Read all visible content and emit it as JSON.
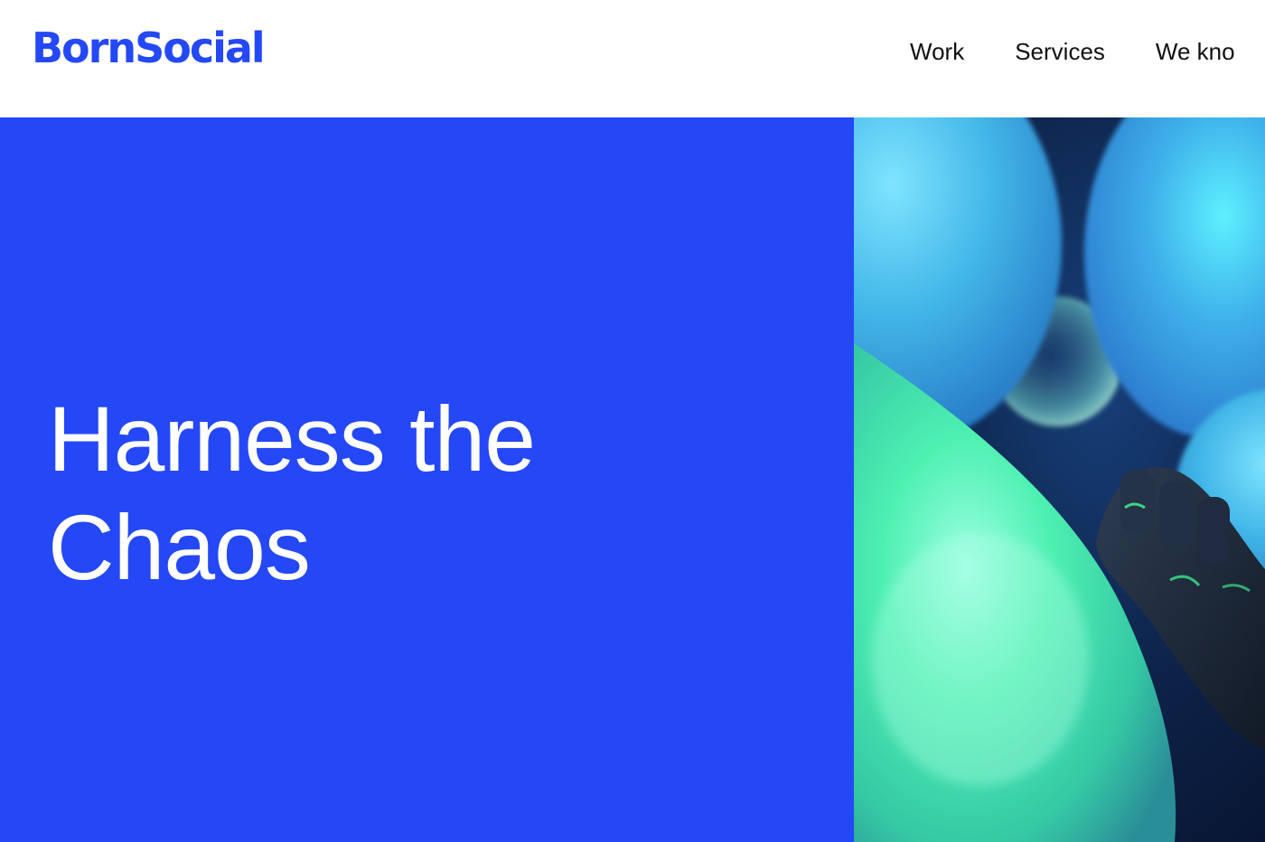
{
  "brand": {
    "name": "BornSocial",
    "color": "#2448f6"
  },
  "nav": {
    "items": [
      {
        "label": "Work"
      },
      {
        "label": "Services"
      },
      {
        "label": "We kno"
      }
    ]
  },
  "hero": {
    "background": "#2448f6",
    "title_line_1": "Harness the",
    "title_line_2": "Chaos",
    "image": {
      "description_icon": "balloons-image",
      "colors": {
        "backdrop": "#0b1b3c",
        "balloon_blue": "#4fc7ea",
        "balloon_green": "#3fe3a0",
        "hand": "#1d2a3a",
        "hand_glow": "#40ff9a"
      }
    }
  }
}
